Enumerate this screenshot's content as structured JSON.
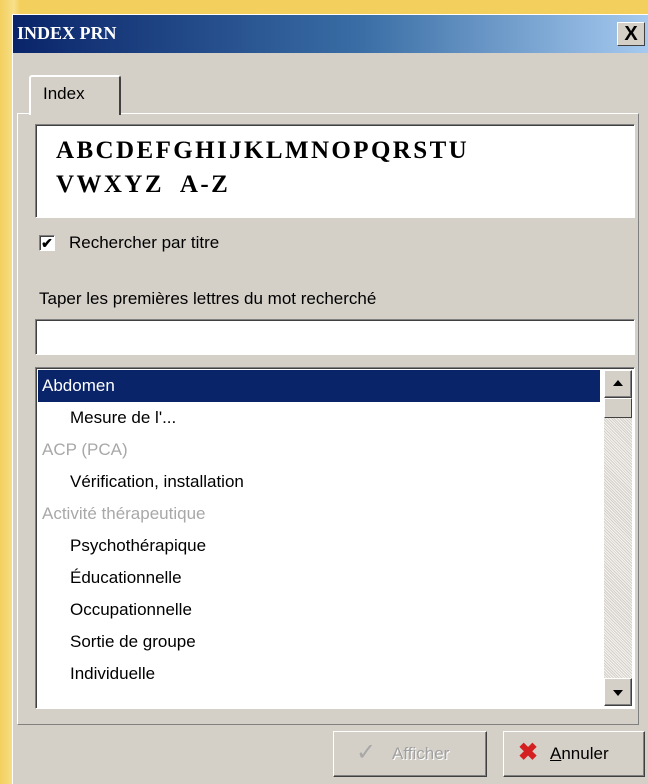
{
  "window": {
    "title": "INDEX PRN",
    "close_label": "X"
  },
  "tabs": [
    {
      "label": "Index"
    }
  ],
  "alphabet": {
    "row1": [
      "A",
      "B",
      "C",
      "D",
      "E",
      "F",
      "G",
      "H",
      "I",
      "J",
      "K",
      "L",
      "M",
      "N",
      "O",
      "P",
      "Q",
      "R",
      "S",
      "T",
      "U"
    ],
    "row2": [
      "V",
      "W",
      "X",
      "Y",
      "Z"
    ],
    "all_label": "A-Z"
  },
  "search_by_title": {
    "label": "Rechercher par titre",
    "checked": true,
    "mark": "✔"
  },
  "search_hint": "Taper les premières lettres du mot recherché",
  "search_input": {
    "value": "",
    "placeholder": ""
  },
  "list": {
    "items": [
      {
        "text": "Abdomen",
        "level": 0,
        "selected": true,
        "category": false
      },
      {
        "text": "Mesure de l'...",
        "level": 1,
        "selected": false,
        "category": false
      },
      {
        "text": "ACP (PCA)",
        "level": 0,
        "selected": false,
        "category": true
      },
      {
        "text": "Vérification, installation",
        "level": 1,
        "selected": false,
        "category": false
      },
      {
        "text": "Activité thérapeutique",
        "level": 0,
        "selected": false,
        "category": true
      },
      {
        "text": "Psychothérapique",
        "level": 1,
        "selected": false,
        "category": false
      },
      {
        "text": "Éducationnelle",
        "level": 1,
        "selected": false,
        "category": false
      },
      {
        "text": "Occupationnelle",
        "level": 1,
        "selected": false,
        "category": false
      },
      {
        "text": "Sortie de groupe",
        "level": 1,
        "selected": false,
        "category": false
      },
      {
        "text": "Individuelle",
        "level": 1,
        "selected": false,
        "category": false
      }
    ]
  },
  "buttons": {
    "show": {
      "label": "Afficher",
      "icon": "checkmark-icon",
      "glyph": "✓",
      "enabled": false
    },
    "cancel": {
      "label": "Annuler",
      "icon": "red-x-icon",
      "glyph": "✖",
      "enabled": true
    }
  },
  "colors": {
    "titlebar": "#0a246a",
    "selection": "#0a246a",
    "cancel_icon": "#d42020"
  }
}
